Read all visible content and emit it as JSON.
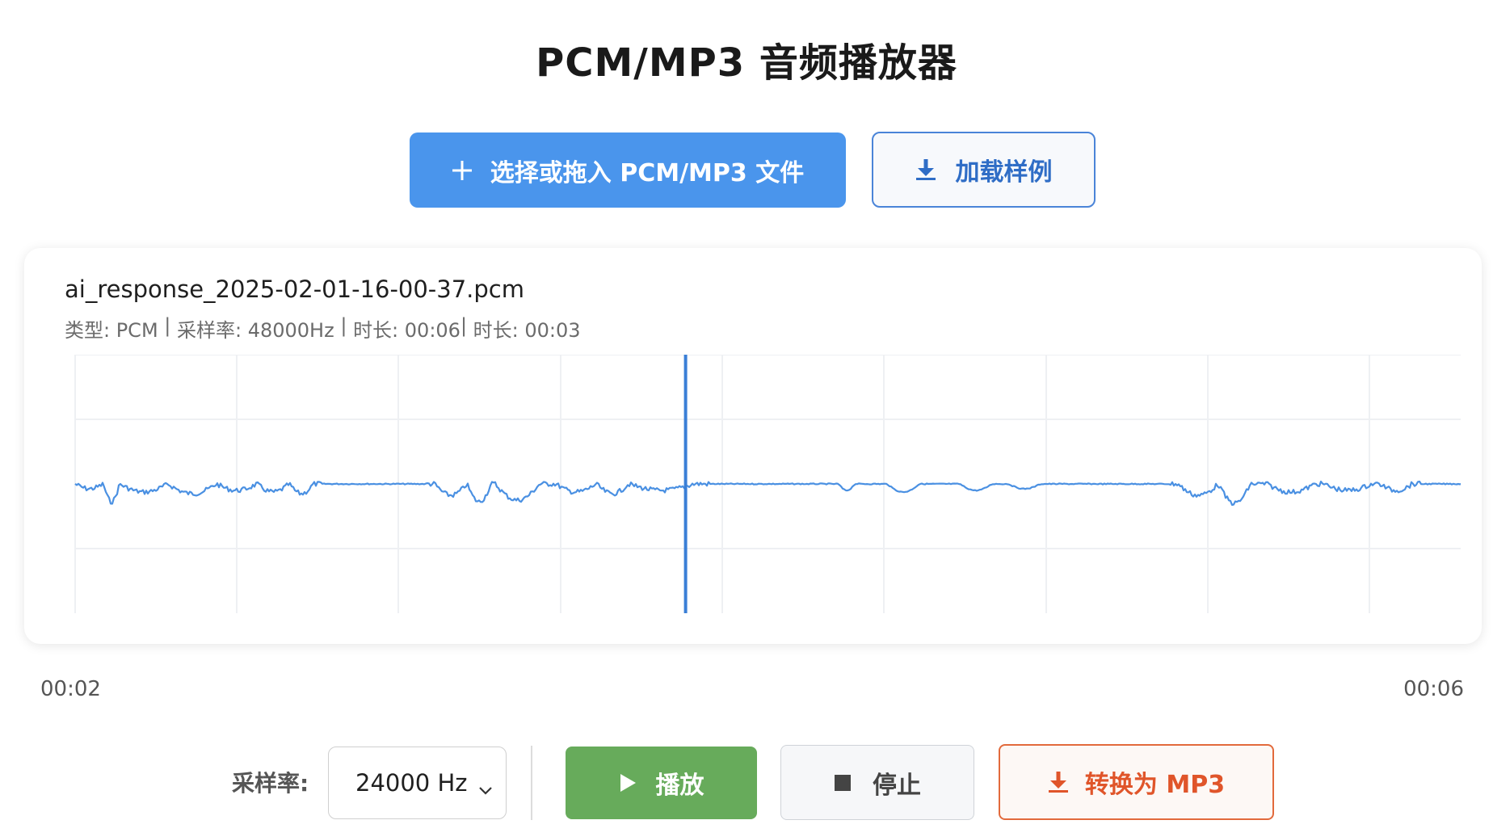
{
  "header": {
    "title": "PCM/MP3 音频播放器"
  },
  "toolbar": {
    "select_file_label": "选择或拖入 PCM/MP3 文件",
    "load_sample_label": "加载样例"
  },
  "file": {
    "name": "ai_response_2025-02-01-16-00-37.pcm",
    "meta_type": "类型: PCM",
    "meta_sample_rate": "采样率: 48000Hz",
    "meta_duration": "时长: 00:06",
    "meta_duration_2": "时长: 00:03"
  },
  "timeline": {
    "start": "00:02",
    "end": "00:06",
    "playhead_fraction": 0.435
  },
  "controls": {
    "sample_rate_label": "采样率:",
    "sample_rate_value": "24000 Hz",
    "play_label": "播放",
    "stop_label": "停止",
    "convert_label": "转换为 MP3"
  },
  "colors": {
    "primary": "#4a95ec",
    "waveform": "#4a90e2",
    "play": "#67ab5b",
    "convert": "#e26a3c"
  },
  "icons": {
    "select_file": "plus-icon",
    "load_sample": "download-icon",
    "play": "play-icon",
    "stop": "stop-icon",
    "convert": "download-icon",
    "select": "chevron-down-icon"
  }
}
